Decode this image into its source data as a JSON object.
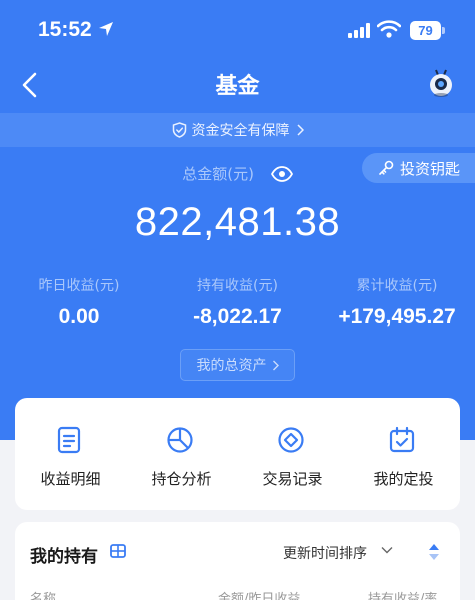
{
  "status_bar": {
    "time": "15:52",
    "battery": "79"
  },
  "nav": {
    "title": "基金"
  },
  "safety_banner": {
    "text": "资金安全有保障"
  },
  "invest_key": {
    "label": "投资钥匙"
  },
  "total": {
    "label": "总金额(元)",
    "amount": "822,481.38"
  },
  "stats": [
    {
      "label": "昨日收益(元)",
      "value": "0.00"
    },
    {
      "label": "持有收益(元)",
      "value": "-8,022.17"
    },
    {
      "label": "累计收益(元)",
      "value": "+179,495.27"
    }
  ],
  "assets_link": {
    "label": "我的总资产"
  },
  "quick_actions": [
    {
      "label": "收益明细",
      "icon": "document-icon"
    },
    {
      "label": "持仓分析",
      "icon": "pie-chart-icon"
    },
    {
      "label": "交易记录",
      "icon": "trade-record-icon"
    },
    {
      "label": "我的定投",
      "icon": "calendar-check-icon"
    }
  ],
  "holdings": {
    "title": "我的持有",
    "sort_label": "更新时间排序",
    "columns": [
      "名称",
      "金额/昨日收益",
      "持有收益/率"
    ]
  },
  "colors": {
    "brand_blue": "#3a7cf4",
    "card_bg": "#ffffff",
    "page_bg": "#f2f3f7"
  }
}
